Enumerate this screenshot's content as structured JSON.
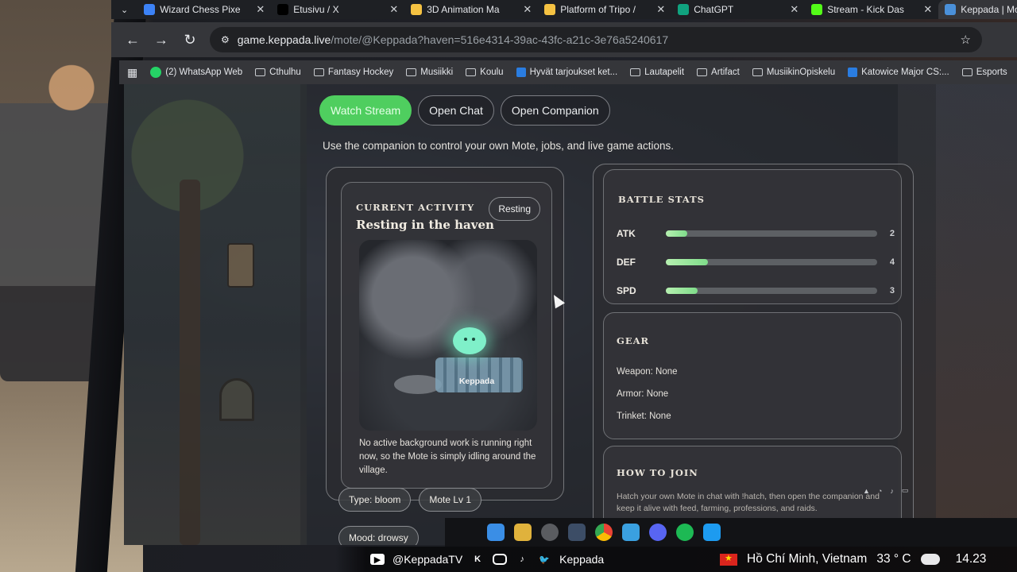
{
  "browser": {
    "tabs": [
      {
        "title": "Wizard Chess Pixe",
        "icon_color": "#3c82f6",
        "active": false
      },
      {
        "title": "Etusivu / X",
        "icon_color": "#000000",
        "active": false
      },
      {
        "title": "3D Animation Ma",
        "icon_color": "#f5c242",
        "active": false
      },
      {
        "title": "Platform of Tripo /",
        "icon_color": "#f5c242",
        "active": false
      },
      {
        "title": "ChatGPT",
        "icon_color": "#10a37f",
        "active": false
      },
      {
        "title": "Stream - Kick Das",
        "icon_color": "#53fc18",
        "active": false
      },
      {
        "title": "Keppada | Moteha",
        "icon_color": "#4a90d9",
        "active": true
      }
    ],
    "url_host": "game.keppada.live",
    "url_path": "/mote/@Keppada?haven=516e4314-39ac-43fc-a21c-3e76a5240617",
    "bookmarks": [
      {
        "label": "(2) WhatsApp Web",
        "icon": "whatsapp-icon"
      },
      {
        "label": "Cthulhu",
        "icon": "folder-icon"
      },
      {
        "label": "Fantasy Hockey",
        "icon": "folder-icon"
      },
      {
        "label": "Musiikki",
        "icon": "folder-icon"
      },
      {
        "label": "Koulu",
        "icon": "folder-icon"
      },
      {
        "label": "Hyvät tarjoukset ket...",
        "icon": "bookmark-icon"
      },
      {
        "label": "Lautapelit",
        "icon": "folder-icon"
      },
      {
        "label": "Artifact",
        "icon": "folder-icon"
      },
      {
        "label": "MusiikinOpiskelu",
        "icon": "folder-icon"
      },
      {
        "label": "Katowice Major CS:...",
        "icon": "bookmark-icon"
      },
      {
        "label": "Esports",
        "icon": "folder-icon"
      }
    ]
  },
  "page": {
    "actions": {
      "watch": "Watch Stream",
      "chat": "Open Chat",
      "companion": "Open Companion"
    },
    "tagline": "Use the companion to control your own Mote, jobs, and live game actions.",
    "activity": {
      "title": "Current Activity",
      "heading": "Resting in the haven",
      "status": "Resting",
      "mote_name": "Keppada",
      "description": "No active background work is running right now, so the Mote is simply idling around the village."
    },
    "chips": {
      "type": "Type: bloom",
      "level": "Mote Lv 1",
      "mood": "Mood: drowsy"
    },
    "battle_stats": {
      "title": "Battle Stats",
      "stats": [
        {
          "label": "ATK",
          "value": "2",
          "fraction": 0.1
        },
        {
          "label": "DEF",
          "value": "4",
          "fraction": 0.2
        },
        {
          "label": "SPD",
          "value": "3",
          "fraction": 0.15
        }
      ]
    },
    "gear": {
      "title": "Gear",
      "weapon": "Weapon: None",
      "armor": "Armor: None",
      "trinket": "Trinket: None"
    },
    "how_to_join": {
      "title": "How to Join",
      "text": "Hatch your own Mote in chat with !hatch, then open the companion and keep it alive with feed, farming, professions, and raids."
    }
  },
  "overlay": {
    "handle": "@KeppadaTV",
    "name": "Keppada",
    "location": "Hồ Chí Minh, Vietnam",
    "temperature": "33 ° C",
    "time": "14.23"
  }
}
